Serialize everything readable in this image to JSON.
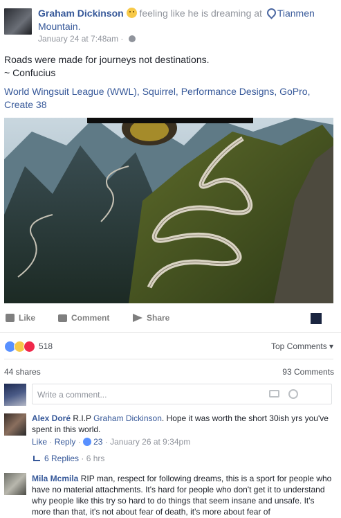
{
  "post": {
    "author": "Graham Dickinson",
    "activity": "feeling like he is dreaming at",
    "place": "Tianmen Mountain.",
    "time": "January 24 at 7:48am",
    "separator": "·",
    "text_line1": "Roads were made for journeys not destinations.",
    "text_line2": "~ Confucius",
    "tags": "World Wingsuit League (WWL), Squirrel, Performance Designs, GoPro, Create 38"
  },
  "actions": {
    "like": "Like",
    "comment": "Comment",
    "share": "Share"
  },
  "stats": {
    "reactions_count": "518",
    "top_comments": "Top Comments",
    "top_comments_caret": "▾",
    "shares": "44 shares",
    "comments": "93 Comments"
  },
  "composer": {
    "placeholder": "Write a comment..."
  },
  "comments": [
    {
      "name": "Alex Doré",
      "text_prefix": "R.I.P ",
      "mention": "Graham Dickinson",
      "text_suffix": ". Hope it was worth the short 30ish yrs you've spent in this world.",
      "like": "Like",
      "reply": "Reply",
      "likes": "23",
      "time": "January 26 at 9:34pm",
      "replies_label": "6 Replies",
      "replies_time": "6 hrs"
    },
    {
      "name": "Mila Mcmila",
      "text": "RIP man, respect for following dreams, this is a sport for people who have no material attachments. It's hard for people who don't get it to understand why people like this try so hard to do things that seem insane and unsafe. It's more than that, it's not about fear of death, it's more about fear of"
    }
  ],
  "colors": {
    "link": "#365899",
    "like_blue": "#5890ff",
    "love_red": "#f0284a",
    "sad_yellow": "#f7c948"
  }
}
